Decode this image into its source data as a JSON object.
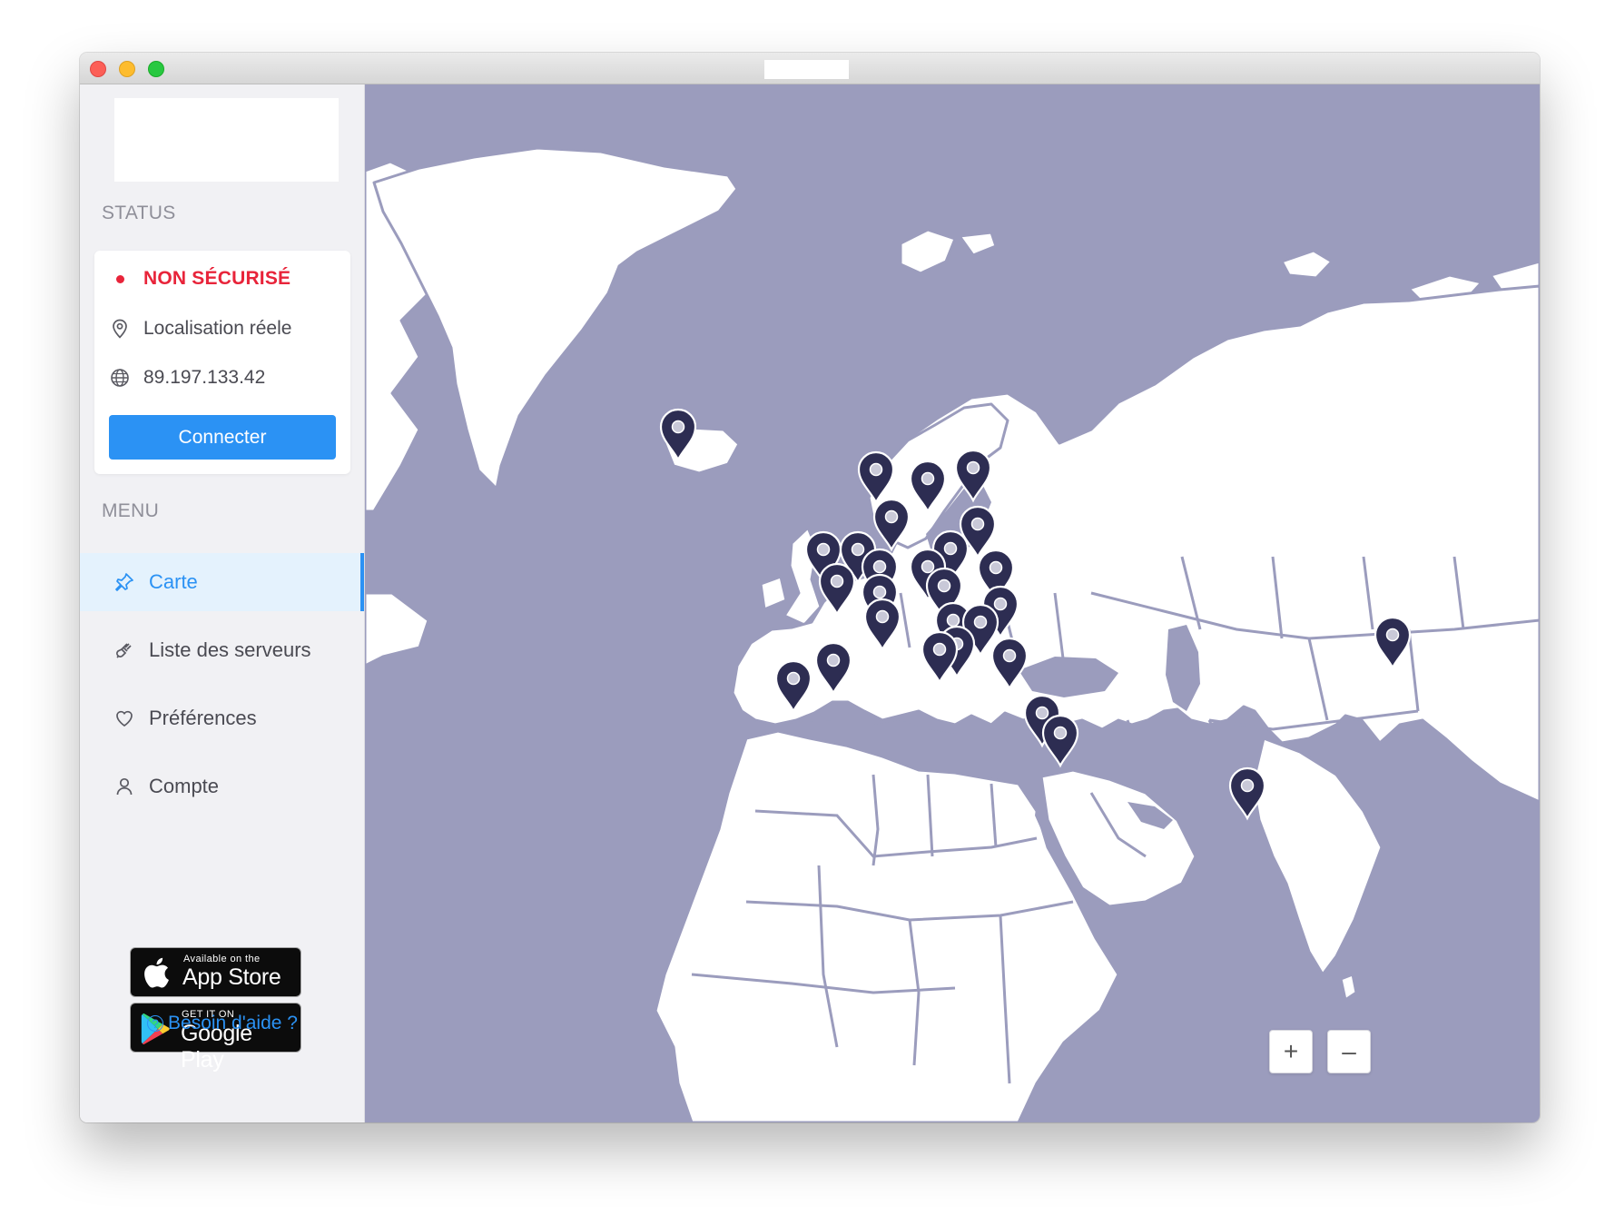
{
  "sidebar": {
    "status_title": "STATUS",
    "status": {
      "state": "NON SÉCURISÉ",
      "location": "Localisation réele",
      "ip": "89.197.133.42",
      "connect_label": "Connecter"
    },
    "menu_title": "MENU",
    "menu": [
      {
        "label": "Carte",
        "icon": "pin-icon",
        "active": true
      },
      {
        "label": "Liste des serveurs",
        "icon": "plug-icon",
        "active": false
      },
      {
        "label": "Préférences",
        "icon": "heart-icon",
        "active": false
      },
      {
        "label": "Compte",
        "icon": "user-icon",
        "active": false
      }
    ],
    "app_store": {
      "small": "Available on the",
      "big": "App Store"
    },
    "google_play": {
      "small": "GET IT ON",
      "big": "Google Play"
    },
    "help_label": "Besoin d'aide ?"
  },
  "map": {
    "zoom_in": "+",
    "zoom_out": "–",
    "colors": {
      "sea": "#9b9cbd",
      "land": "#ffffff",
      "marker": "#2d2d52"
    }
  },
  "colors": {
    "accent": "#2b92f4",
    "danger": "#e8243a"
  }
}
